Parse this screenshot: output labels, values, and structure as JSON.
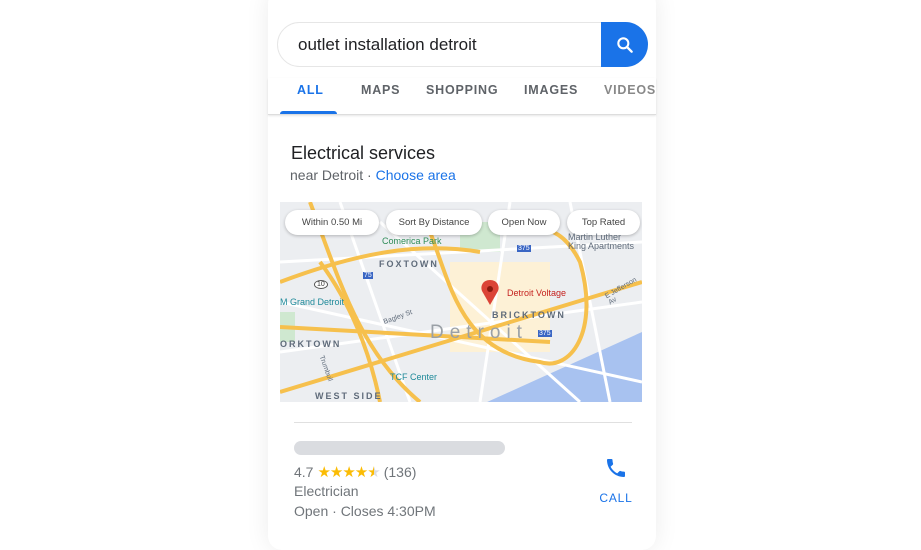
{
  "search": {
    "query": "outlet installation detroit",
    "icon": "search-icon"
  },
  "tabs": [
    {
      "label": "ALL",
      "active": true
    },
    {
      "label": "MAPS"
    },
    {
      "label": "SHOPPING"
    },
    {
      "label": "IMAGES"
    },
    {
      "label": "VIDEOS"
    }
  ],
  "section": {
    "title": "Electrical services",
    "near": "near Detroit · ",
    "choose": "Choose area"
  },
  "map": {
    "chips": [
      "Within 0.50 Mi",
      "Sort By Distance",
      "Open Now",
      "Top Rated"
    ],
    "labels": {
      "comerica": "Comerica Park",
      "mlk1": "Martin Luther",
      "mlk2": "King Apartments",
      "foxtown": "FOXTOWN",
      "mgm": "M Grand Detroit",
      "pin": "Detroit Voltage",
      "bricktown": "BRICKTOWN",
      "detroit": "Detroit",
      "corktown": "ORKTOWN",
      "tcf": "TCF Center",
      "westside": "WEST SIDE",
      "bagley": "Bagley St",
      "trumbull": "Trumbull",
      "jefferson": "E Jefferson Av",
      "i375a": "375",
      "i375b": "375",
      "i75": "75",
      "r10": "10"
    },
    "pin_color": "#db4437",
    "water_color": "#a8c2f0"
  },
  "result": {
    "rating": "4.7",
    "stars": "★★★★",
    "half": "★",
    "rating_value": 4.7,
    "reviews": "(136)",
    "category": "Electrician",
    "hours": "Open · Closes 4:30PM",
    "call_label": "CALL"
  },
  "colors": {
    "accent": "#1a73e8",
    "star": "#fbbc04"
  }
}
